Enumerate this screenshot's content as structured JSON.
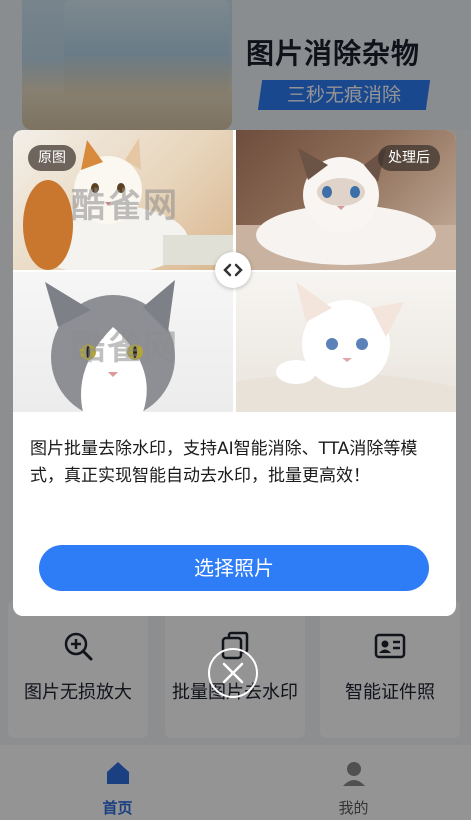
{
  "hero": {
    "title": "图片消除杂物",
    "subtitle": "三秒无痕消除"
  },
  "tools": [
    {
      "label": "图片无损放大",
      "icon": "zoom-in-icon"
    },
    {
      "label": "批量图片去水印",
      "icon": "copy-icon"
    },
    {
      "label": "智能证件照",
      "icon": "id-card-icon"
    }
  ],
  "tabbar": {
    "home": {
      "label": "首页",
      "icon": "home-icon",
      "active": true
    },
    "mine": {
      "label": "我的",
      "icon": "user-icon",
      "active": false
    }
  },
  "modal": {
    "tag_original": "原图",
    "tag_processed": "处理后",
    "watermark": "酷雀网",
    "description": "图片批量去除水印，支持AI智能消除、TTA消除等模式，真正实现智能自动去水印，批量更高效！",
    "cta_label": "选择照片",
    "compare_icon": "chevron-left-right-icon",
    "close_icon": "close-icon"
  },
  "colors": {
    "accent": "#2e7df6",
    "active_tab": "#2e6fe0",
    "inactive_tab": "#8a8a8a"
  }
}
